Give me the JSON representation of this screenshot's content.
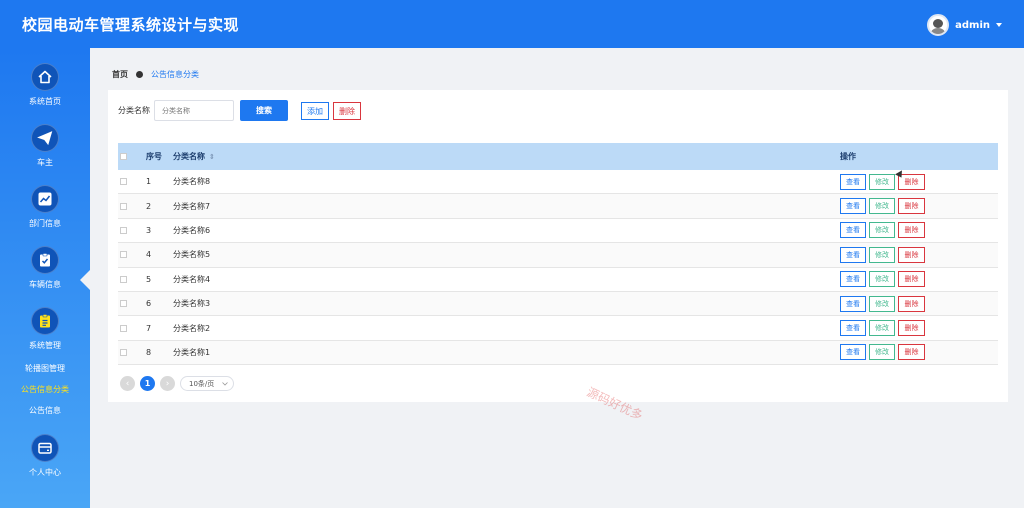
{
  "header": {
    "title": "校园电动车管理系统设计与实现",
    "username": "admin"
  },
  "sidebar": {
    "items": [
      {
        "label": "系统首页",
        "icon": "home-icon"
      },
      {
        "label": "车主",
        "icon": "send-icon"
      },
      {
        "label": "部门信息",
        "icon": "chart-icon"
      },
      {
        "label": "车辆信息",
        "icon": "clipboard-check-icon"
      },
      {
        "label": "系统管理",
        "icon": "clipboard-list-icon"
      },
      {
        "label": "个人中心",
        "icon": "wallet-icon"
      }
    ],
    "sub_items": [
      {
        "label": "轮播图管理",
        "active": false
      },
      {
        "label": "公告信息分类",
        "active": true
      },
      {
        "label": "公告信息",
        "active": false
      }
    ]
  },
  "breadcrumb": {
    "home": "首页",
    "current": "公告信息分类"
  },
  "search": {
    "label": "分类名称",
    "placeholder": "分类名称",
    "search_label": "搜索",
    "add_label": "添加",
    "delete_label": "删除"
  },
  "table": {
    "headers": {
      "number": "序号",
      "name": "分类名称",
      "name_sort": "⇕",
      "actions": "操作"
    },
    "rows": [
      {
        "number": "1",
        "name": "分类名称8"
      },
      {
        "number": "2",
        "name": "分类名称7"
      },
      {
        "number": "3",
        "name": "分类名称6"
      },
      {
        "number": "4",
        "name": "分类名称5"
      },
      {
        "number": "5",
        "name": "分类名称4"
      },
      {
        "number": "6",
        "name": "分类名称3"
      },
      {
        "number": "7",
        "name": "分类名称2"
      },
      {
        "number": "8",
        "name": "分类名称1"
      }
    ],
    "row_actions": {
      "view": "查看",
      "edit": "修改",
      "delete": "删除"
    }
  },
  "pagination": {
    "current_page": "1",
    "page_size": "10条/页",
    "prev": "‹",
    "next": "›"
  },
  "watermark": "源码好优多",
  "colors": {
    "primary": "#1e78f0",
    "success": "#43b88f",
    "danger": "#d9363e",
    "active_sub": "#ffe11a"
  }
}
